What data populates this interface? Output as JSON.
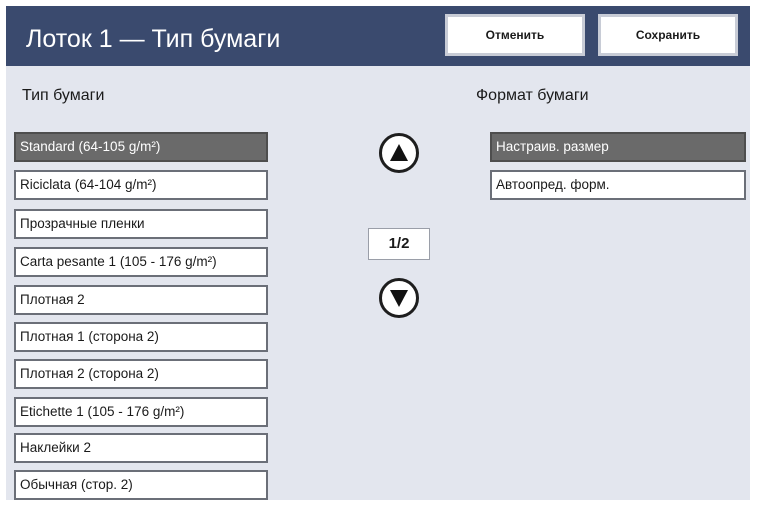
{
  "header": {
    "title": "Лоток 1 — Тип бумаги",
    "cancel_label": "Отменить",
    "save_label": "Сохранить"
  },
  "paper_type": {
    "label": "Тип бумаги",
    "selected_index": 0,
    "items": [
      {
        "label": "Standard (64-105 g/m²)"
      },
      {
        "label": "Riciclata (64-104 g/m²)"
      },
      {
        "label": "Прозрачные пленки"
      },
      {
        "label": "Carta pesante 1 (105 - 176 g/m²)"
      },
      {
        "label": "Плотная 2"
      },
      {
        "label": "Плотная 1 (сторона 2)"
      },
      {
        "label": "Плотная 2 (сторона 2)"
      },
      {
        "label": "Etichette 1 (105 - 176 g/m²)"
      },
      {
        "label": "Наклейки 2"
      },
      {
        "label": "Обычная (стор. 2)"
      }
    ]
  },
  "pagination": {
    "current_page": "1/2"
  },
  "paper_format": {
    "label": "Формат бумаги",
    "selected_index": 0,
    "items": [
      {
        "label": "Настраив. размер"
      },
      {
        "label": "Автоопред. форм."
      }
    ]
  },
  "icons": {
    "scroll_up": "arrow-up-icon",
    "scroll_down": "arrow-down-icon"
  },
  "colors": {
    "header_bg": "#3a4a6e",
    "panel_bg": "#e3e6ee",
    "selected_bg": "#6a6a6a"
  }
}
